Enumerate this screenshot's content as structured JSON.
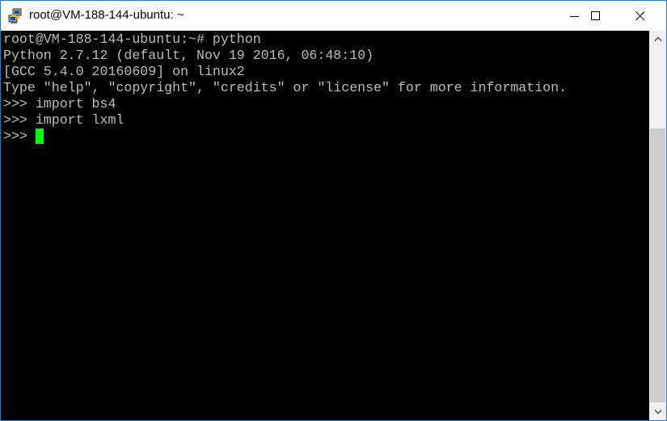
{
  "window": {
    "title": "root@VM-188-144-ubuntu: ~",
    "app_icon": "putty-icon",
    "controls": {
      "minimize": "minimize-icon",
      "maximize": "maximize-icon",
      "close": "close-icon"
    }
  },
  "terminal": {
    "lines": [
      "root@VM-188-144-ubuntu:~# python",
      "Python 2.7.12 (default, Nov 19 2016, 06:48:10)",
      "[GCC 5.4.0 20160609] on linux2",
      "Type \"help\", \"copyright\", \"credits\" or \"license\" for more information.",
      ">>> import bs4",
      ">>> import lxml",
      ">>> "
    ],
    "cursor_color": "#00ff00",
    "text_color": "#bbbbbb",
    "background": "#000000"
  },
  "scrollbar": {
    "up_icon": "chevron-up-icon",
    "down_icon": "chevron-down-icon"
  }
}
